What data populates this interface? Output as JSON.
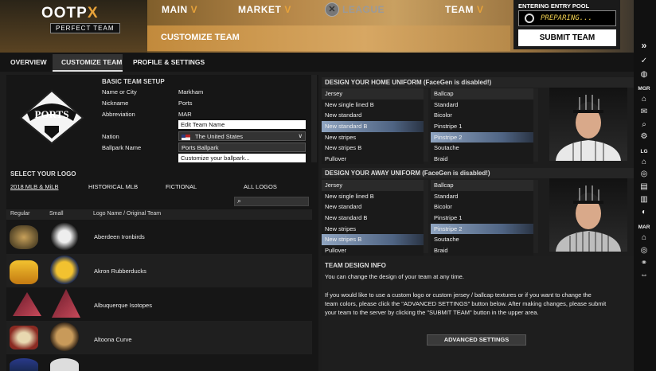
{
  "brand": {
    "name_a": "OOTP",
    "name_b": "X",
    "sub": "PERFECT TEAM"
  },
  "nav": {
    "main": "MAIN",
    "market": "MARKET",
    "league": "LEAGUE",
    "team": "TEAM",
    "chevron": "V"
  },
  "page": {
    "title": "CUSTOMIZE TEAM"
  },
  "entry": {
    "label": "ENTERING ENTRY POOL",
    "status": "PREPARING...",
    "submit": "SUBMIT TEAM"
  },
  "tabs": [
    "OVERVIEW",
    "CUSTOMIZE TEAM",
    "PROFILE & SETTINGS"
  ],
  "team_setup": {
    "heading": "BASIC TEAM SETUP",
    "logo_text": "PORTS",
    "fields": [
      {
        "label": "Name or City",
        "value": "Markham"
      },
      {
        "label": "Nickname",
        "value": "Ports"
      },
      {
        "label": "Abbreviation",
        "value": "MAR"
      }
    ],
    "edit_team_name": "Edit Team Name",
    "nation_label": "Nation",
    "nation_value": "The United States",
    "ballpark_label": "Ballpark Name",
    "ballpark_value": "Ports Ballpark",
    "customize_ballpark": "Customize your ballpark..."
  },
  "logo_select": {
    "heading": "SELECT YOUR LOGO",
    "filters": [
      "2018 MLB & MiLB",
      "HISTORICAL MLB",
      "FICTIONAL",
      "ALL LOGOS"
    ],
    "columns": [
      "Regular",
      "Small",
      "Logo Name / Original Team"
    ],
    "rows": [
      {
        "name": "Aberdeen Ironbirds"
      },
      {
        "name": "Akron Rubberducks"
      },
      {
        "name": "Albuquerque Isotopes"
      },
      {
        "name": "Altoona Curve"
      }
    ]
  },
  "home_uniform": {
    "heading": "DESIGN YOUR HOME UNIFORM (FaceGen is disabled!)",
    "jersey_header": "Jersey",
    "ballcap_header": "Ballcap",
    "jerseys": [
      "New single lined B",
      "New standard",
      "New standard B",
      "New stripes",
      "New stripes B",
      "Pullover"
    ],
    "ballcaps": [
      "Standard",
      "Bicolor",
      "Pinstripe 1",
      "Pinstripe 2",
      "Soutache",
      "Braid"
    ]
  },
  "away_uniform": {
    "heading": "DESIGN YOUR AWAY UNIFORM (FaceGen is disabled!)",
    "jersey_header": "Jersey",
    "ballcap_header": "Ballcap",
    "jerseys": [
      "New single lined B",
      "New standard",
      "New standard B",
      "New stripes",
      "New stripes B",
      "Pullover"
    ],
    "ballcaps": [
      "Standard",
      "Bicolor",
      "Pinstripe 1",
      "Pinstripe 2",
      "Soutache",
      "Braid"
    ]
  },
  "info": {
    "heading": "TEAM DESIGN INFO",
    "line1": "You can change the design of your team at any time.",
    "line2": "If you would like to use a custom logo or custom jersey / ballcap textures or if you want to change the",
    "line3": "team colors, please click the \"ADVANCED SETTINGS\" button below. After making changes, please submit",
    "line4": "your team to the server by clicking the \"SUBMIT TEAM\" button in the upper area.",
    "advanced": "ADVANCED SETTINGS"
  },
  "sidebar": {
    "mgr": "MGR",
    "lg": "LG",
    "mar": "MAR",
    "collapse": "»"
  },
  "colors": {
    "accent": "#e8a33a",
    "selected_row": "#4f6483",
    "status_text": "#f3d24f"
  }
}
